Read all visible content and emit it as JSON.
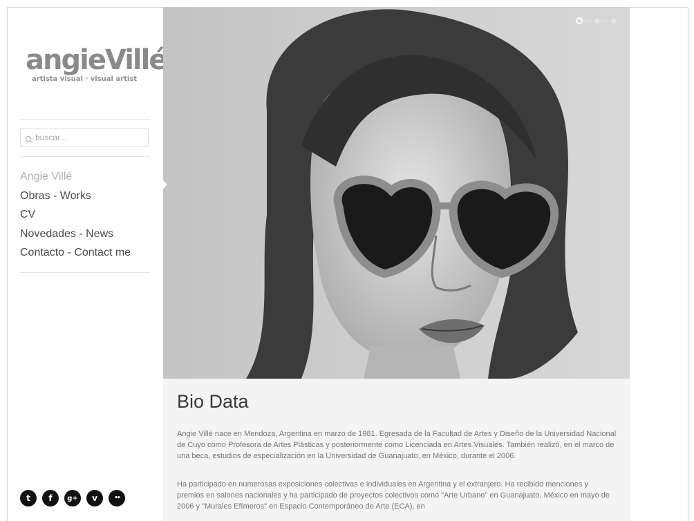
{
  "logo": {
    "main": "angieVillé",
    "subtitle": "artista visual · visual artist"
  },
  "search": {
    "placeholder": "buscar..."
  },
  "nav": [
    {
      "label": "Angie Villé",
      "active": true
    },
    {
      "label": "Obras - Works"
    },
    {
      "label": "CV"
    },
    {
      "label": "Novedades - News"
    },
    {
      "label": "Contacto - Contact me"
    }
  ],
  "social": [
    {
      "icon": "twitter-icon",
      "glyph": "t"
    },
    {
      "icon": "facebook-icon",
      "glyph": "f"
    },
    {
      "icon": "google-plus-icon",
      "glyph": "g+"
    },
    {
      "icon": "vimeo-icon",
      "glyph": "v"
    },
    {
      "icon": "flickr-icon",
      "glyph": "••"
    }
  ],
  "slider": {
    "count": 3,
    "active": 1
  },
  "bio": {
    "title": "Bio Data",
    "paragraphs": [
      "Angie Villé  nace en Mendoza,  Argentina en marzo de 1981. Egresada de la Facultad de Artes y Diseño de la Universidad Nacional de Cuyo como Profesora de Artes Plásticas y posteriormente como Licenciada en Artes Visuales. También realizó, en el marco de una beca, estudios de especialización en la Universidad de Guanajuato, en México, durante el 2006.",
      "Ha participado en numerosas exposiciones colectivas e individuales en Argentina y el extranjero. Ha recibido menciones y premios en salones nacionales y ha participado de proyectos colectivos como \"Arte Urbano\" en Guanajuato, México en mayo de 2006 y \"Murales Efímeros\" en Espacio Contemporáneo de Arte (ECA), en"
    ]
  }
}
